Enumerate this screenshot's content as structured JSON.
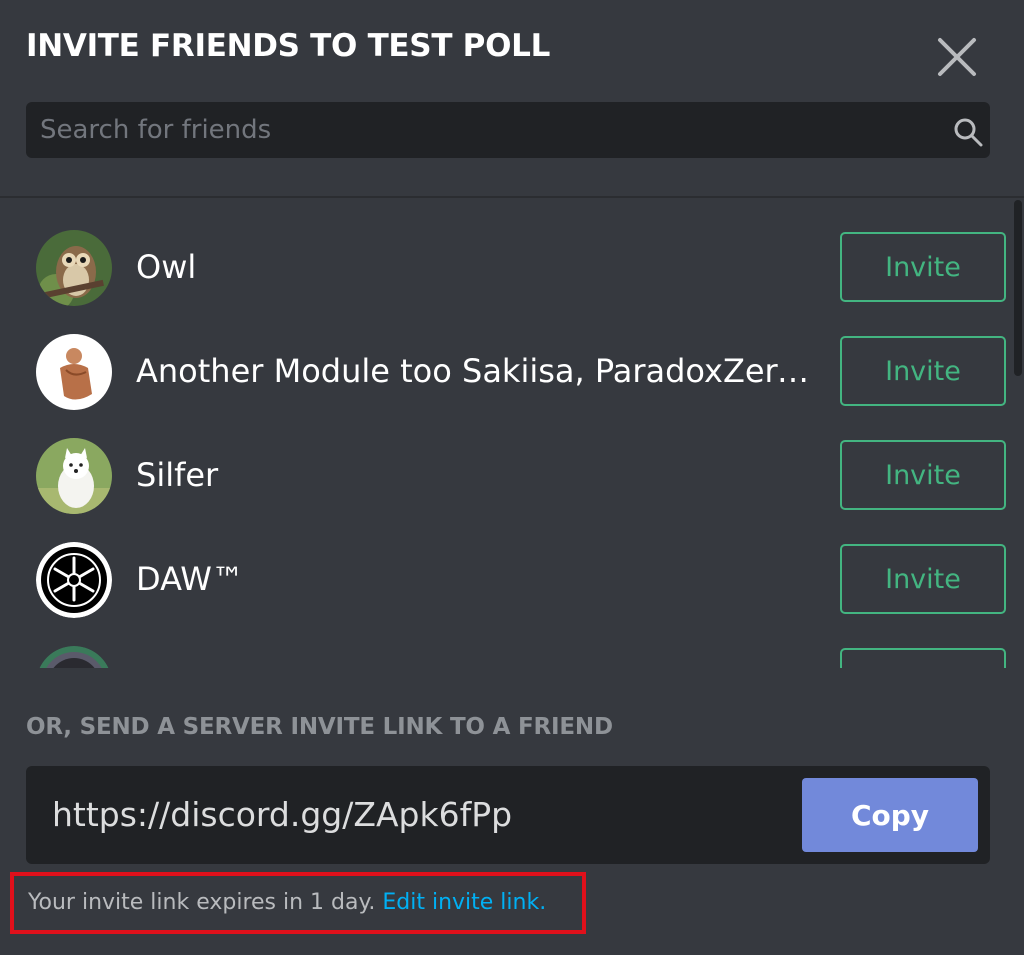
{
  "modal": {
    "title": "INVITE FRIENDS TO TEST POLL",
    "close_icon": "close-icon"
  },
  "search": {
    "placeholder": "Search for friends",
    "value": "",
    "icon": "search-icon"
  },
  "friends": [
    {
      "name": "Owl",
      "avatar": "owl-avatar",
      "button": "Invite"
    },
    {
      "name": "Another Module too Sakiisa, ParadoxZero,...",
      "avatar": "group-avatar",
      "button": "Invite"
    },
    {
      "name": "Silfer",
      "avatar": "dog-avatar",
      "button": "Invite"
    },
    {
      "name": "DAW™",
      "avatar": "yamaha-logo-avatar",
      "button": "Invite"
    },
    {
      "name": "",
      "avatar": "partial-avatar",
      "button": ""
    }
  ],
  "invite_link": {
    "section_label": "OR, SEND A SERVER INVITE LINK TO A FRIEND",
    "url": "https://discord.gg/ZApk6fPp",
    "copy_label": "Copy",
    "expiry_text": "Your invite link expires in 1 day.",
    "edit_label": "Edit invite link."
  },
  "colors": {
    "background": "#36393f",
    "input_background": "#202225",
    "invite_green": "#43b581",
    "copy_blurple": "#7289da",
    "link_blue": "#00b0f4",
    "highlight_red": "#e0101b"
  }
}
